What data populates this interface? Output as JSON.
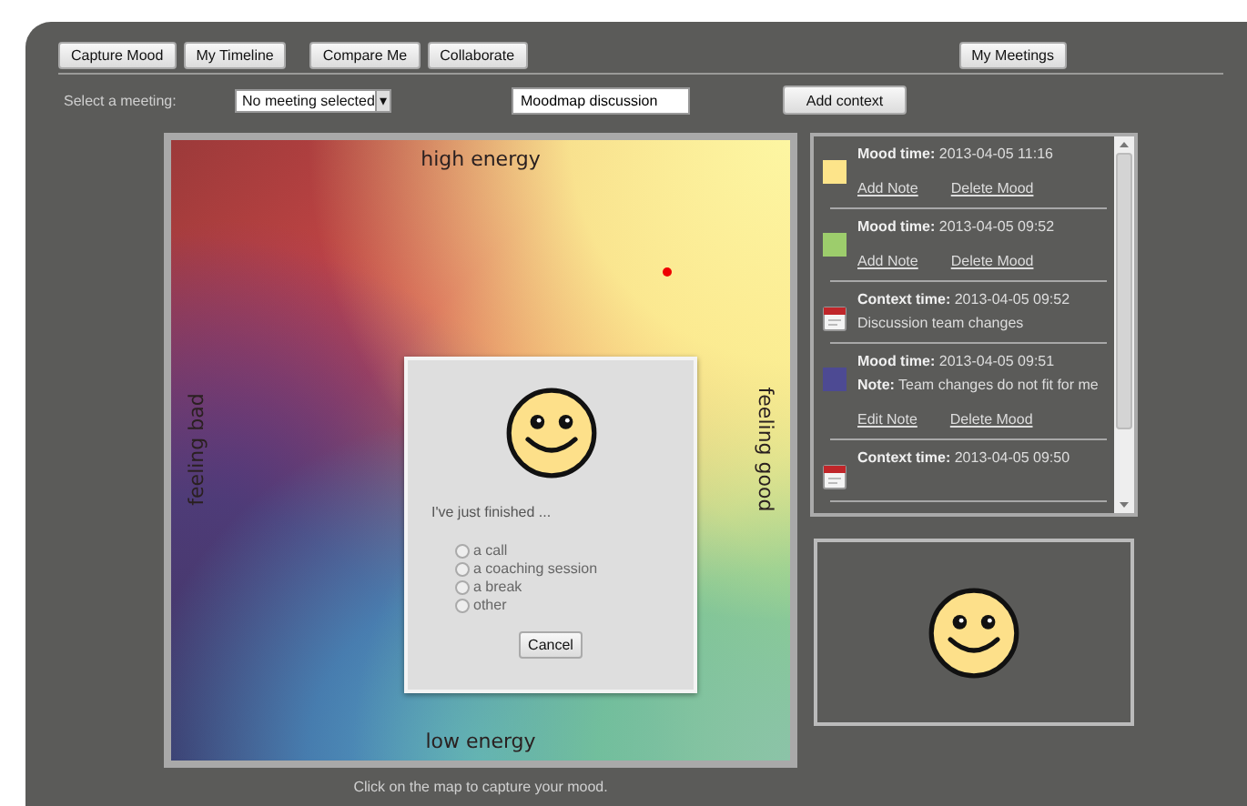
{
  "tabs": [
    {
      "label": "Capture Mood"
    },
    {
      "label": "My Timeline"
    },
    {
      "label": "Compare Me"
    },
    {
      "label": "Collaborate"
    }
  ],
  "meetings_tab": {
    "label": "My Meetings"
  },
  "meeting_select": {
    "label": "Select a meeting:",
    "value": "No meeting selected",
    "arrow": "▾"
  },
  "context_field": {
    "value": "Moodmap discussion"
  },
  "add_context_button": "Add context",
  "mood_map": {
    "top": "high energy",
    "bottom": "low energy",
    "left": "feeling bad",
    "right": "feeling good",
    "caption": "Click on the map to capture your mood."
  },
  "dialog": {
    "prompt": "I've just finished ...",
    "options": [
      {
        "label": "a call",
        "selected": false
      },
      {
        "label": "a coaching session",
        "selected": false
      },
      {
        "label": "a break",
        "selected": false
      },
      {
        "label": "other",
        "selected": false
      }
    ],
    "cancel": "Cancel"
  },
  "entries": [
    {
      "kind": "mood",
      "color": "#fde48a",
      "label": "Mood time:",
      "time": "2013-04-05 11:16",
      "links": [
        "Add Note",
        "Delete Mood"
      ]
    },
    {
      "kind": "mood",
      "color": "#9dcd6c",
      "label": "Mood time:",
      "time": "2013-04-05 09:52",
      "links": [
        "Add Note",
        "Delete Mood"
      ]
    },
    {
      "kind": "context",
      "label": "Context time:",
      "time": "2013-04-05 09:52",
      "text": "Discussion team changes"
    },
    {
      "kind": "mood",
      "color": "#4d4a93",
      "label": "Mood time:",
      "time": "2013-04-05 09:51",
      "note_label": "Note:",
      "note": "Team changes do not fit for me",
      "links": [
        "Edit Note",
        "Delete Mood"
      ]
    },
    {
      "kind": "context",
      "label": "Context time:",
      "time": "2013-04-05 09:50"
    }
  ]
}
